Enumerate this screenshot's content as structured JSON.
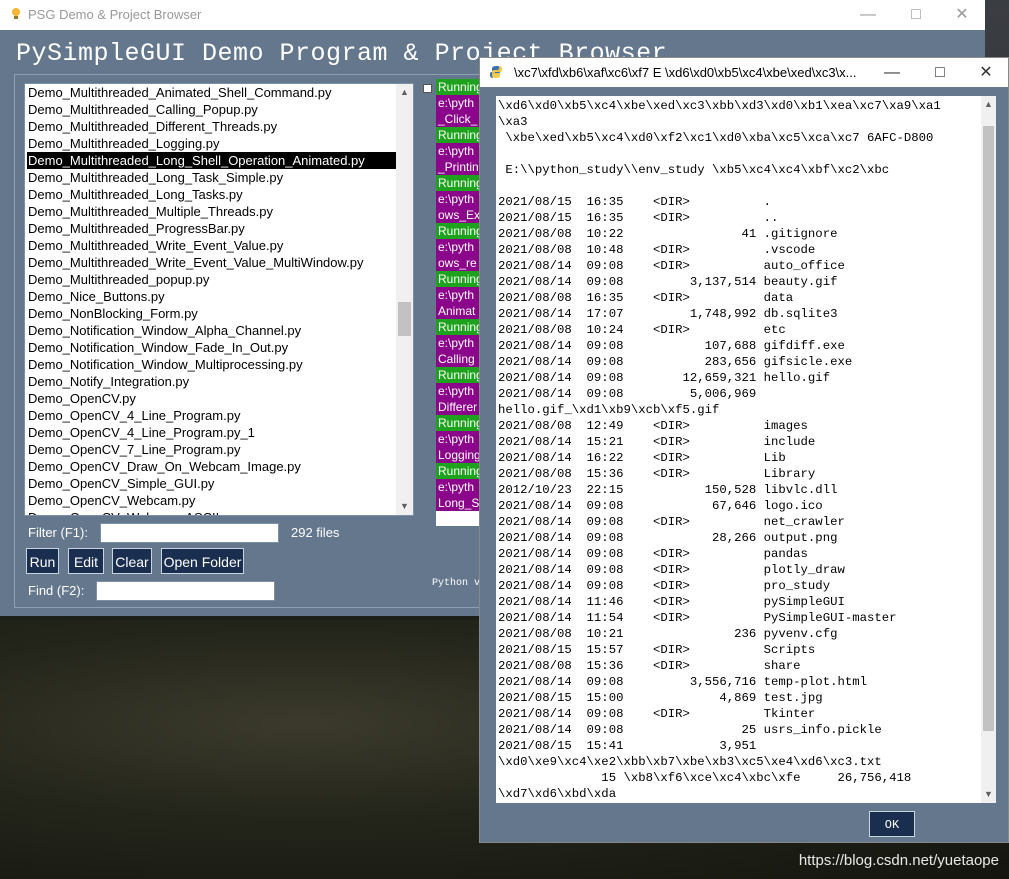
{
  "main": {
    "window_title": "PSG Demo & Project Browser",
    "headline": "PySimpleGUI Demo Program & Project Browser",
    "files": [
      "Demo_Multithreaded_Animated_Shell_Command.py",
      "Demo_Multithreaded_Calling_Popup.py",
      "Demo_Multithreaded_Different_Threads.py",
      "Demo_Multithreaded_Logging.py",
      "Demo_Multithreaded_Long_Shell_Operation_Animated.py",
      "Demo_Multithreaded_Long_Task_Simple.py",
      "Demo_Multithreaded_Long_Tasks.py",
      "Demo_Multithreaded_Multiple_Threads.py",
      "Demo_Multithreaded_ProgressBar.py",
      "Demo_Multithreaded_Write_Event_Value.py",
      "Demo_Multithreaded_Write_Event_Value_MultiWindow.py",
      "Demo_Multithreaded_popup.py",
      "Demo_Nice_Buttons.py",
      "Demo_NonBlocking_Form.py",
      "Demo_Notification_Window_Alpha_Channel.py",
      "Demo_Notification_Window_Fade_In_Out.py",
      "Demo_Notification_Window_Multiprocessing.py",
      "Demo_Notify_Integration.py",
      "Demo_OpenCV.py",
      "Demo_OpenCV_4_Line_Program.py",
      "Demo_OpenCV_4_Line_Program.py_1",
      "Demo_OpenCV_7_Line_Program.py",
      "Demo_OpenCV_Draw_On_Webcam_Image.py",
      "Demo_OpenCV_Simple_GUI.py",
      "Demo_OpenCV_Webcam.py",
      "Demo_OpenCV_Webcam_ASCII..."
    ],
    "selected_file": "Demo_Multithreaded_Long_Shell_Operation_Animated.py",
    "filter_label": "Filter (F1):",
    "filter_value": "",
    "file_count": "292 files",
    "buttons": {
      "run": "Run",
      "edit": "Edit",
      "clear": "Clear",
      "open_folder": "Open Folder"
    },
    "find_label": "Find (F2):",
    "find_value": "",
    "python_version": "Python v",
    "output_lines": [
      {
        "text": "Running",
        "style": "g"
      },
      {
        "text": "e:\\pyth",
        "style": "p"
      },
      {
        "text": "_Click_",
        "style": "p"
      },
      {
        "text": "Running",
        "style": "g"
      },
      {
        "text": "e:\\pyth",
        "style": "p"
      },
      {
        "text": "_Printin",
        "style": "p"
      },
      {
        "text": "Running",
        "style": "g"
      },
      {
        "text": "e:\\pyth",
        "style": "p"
      },
      {
        "text": "ows_Ex",
        "style": "p"
      },
      {
        "text": "Running",
        "style": "g"
      },
      {
        "text": "e:\\pyth",
        "style": "p"
      },
      {
        "text": "ows_re",
        "style": "p"
      },
      {
        "text": "Running",
        "style": "g"
      },
      {
        "text": "e:\\pyth",
        "style": "p"
      },
      {
        "text": "Animat",
        "style": "p"
      },
      {
        "text": "Running",
        "style": "g"
      },
      {
        "text": "e:\\pyth",
        "style": "p"
      },
      {
        "text": "Calling",
        "style": "p"
      },
      {
        "text": "Running",
        "style": "g"
      },
      {
        "text": "e:\\pyth",
        "style": "p"
      },
      {
        "text": "Differer",
        "style": "p"
      },
      {
        "text": "Running",
        "style": "g"
      },
      {
        "text": "e:\\pyth",
        "style": "p"
      },
      {
        "text": "Logging",
        "style": "p"
      },
      {
        "text": "Running",
        "style": "g"
      },
      {
        "text": "e:\\pyth",
        "style": "p"
      },
      {
        "text": "Long_S",
        "style": "p"
      }
    ]
  },
  "popup": {
    "window_title": "\\xc7\\xfd\\xb6\\xaf\\xc6\\xf7 E \\xd6\\xd0\\xb5\\xc4\\xbe\\xed\\xc3\\x...",
    "lines": [
      "\\xd6\\xd0\\xb5\\xc4\\xbe\\xed\\xc3\\xbb\\xd3\\xd0\\xb1\\xea\\xc7\\xa9\\xa1",
      "\\xa3",
      " \\xbe\\xed\\xb5\\xc4\\xd0\\xf2\\xc1\\xd0\\xba\\xc5\\xca\\xc7 6AFC-D800",
      "",
      " E:\\\\python_study\\\\env_study \\xb5\\xc4\\xc4\\xbf\\xc2\\xbc",
      "",
      "2021/08/15  16:35    <DIR>          .",
      "2021/08/15  16:35    <DIR>          ..",
      "2021/08/08  10:22                41 .gitignore",
      "2021/08/08  10:48    <DIR>          .vscode",
      "2021/08/14  09:08    <DIR>          auto_office",
      "2021/08/14  09:08         3,137,514 beauty.gif",
      "2021/08/08  16:35    <DIR>          data",
      "2021/08/14  17:07         1,748,992 db.sqlite3",
      "2021/08/08  10:24    <DIR>          etc",
      "2021/08/14  09:08           107,688 gifdiff.exe",
      "2021/08/14  09:08           283,656 gifsicle.exe",
      "2021/08/14  09:08        12,659,321 hello.gif",
      "2021/08/14  09:08         5,006,969",
      "hello.gif_\\xd1\\xb9\\xcb\\xf5.gif",
      "2021/08/08  12:49    <DIR>          images",
      "2021/08/14  15:21    <DIR>          include",
      "2021/08/14  16:22    <DIR>          Lib",
      "2021/08/08  15:36    <DIR>          Library",
      "2012/10/23  22:15           150,528 libvlc.dll",
      "2021/08/14  09:08            67,646 logo.ico",
      "2021/08/14  09:08    <DIR>          net_crawler",
      "2021/08/14  09:08            28,266 output.png",
      "2021/08/14  09:08    <DIR>          pandas",
      "2021/08/14  09:08    <DIR>          plotly_draw",
      "2021/08/14  09:08    <DIR>          pro_study",
      "2021/08/14  11:46    <DIR>          pySimpleGUI",
      "2021/08/14  11:54    <DIR>          PySimpleGUI-master",
      "2021/08/08  10:21               236 pyvenv.cfg",
      "2021/08/15  15:57    <DIR>          Scripts",
      "2021/08/08  15:36    <DIR>          share",
      "2021/08/14  09:08         3,556,716 temp-plot.html",
      "2021/08/15  15:00             4,869 test.jpg",
      "2021/08/14  09:08    <DIR>          Tkinter",
      "2021/08/14  09:08                25 usrs_info.pickle",
      "2021/08/15  15:41             3,951",
      "\\xd0\\xe9\\xc4\\xe2\\xbb\\xb7\\xbe\\xb3\\xc5\\xe4\\xd6\\xc3.txt",
      "              15 \\xb8\\xf6\\xce\\xc4\\xbc\\xfe     26,756,418",
      "\\xd7\\xd6\\xbd\\xda"
    ],
    "ok_label": "OK"
  },
  "watermark": "https://blog.csdn.net/yuetaope",
  "colors": {
    "window_bg": "#64778d",
    "button_bg": "#1a2e4f",
    "selection": "#000000",
    "output_green": "#1ea21e",
    "output_purple": "#8b058b"
  },
  "icons": {
    "app": "lightbulb-icon",
    "popup": "python-icon"
  }
}
